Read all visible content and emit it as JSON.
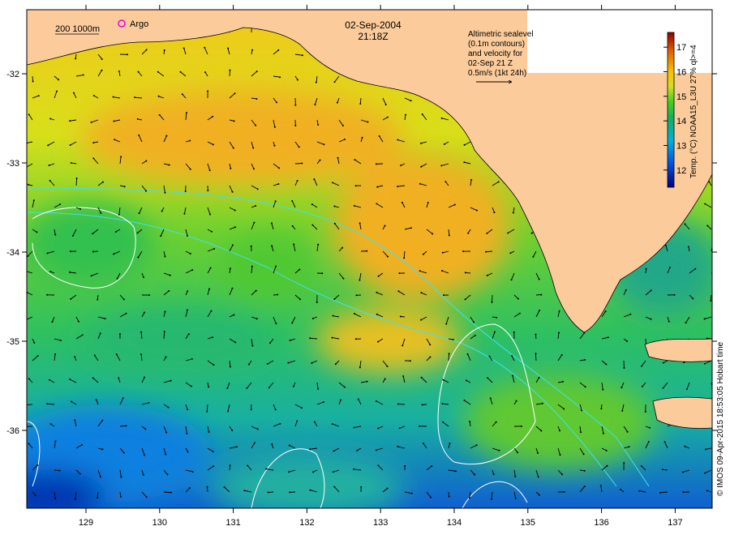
{
  "title": {
    "date": "02-Sep-2004",
    "time": "21:18Z"
  },
  "legend": {
    "isobaths": "200  1000m",
    "argo": "Argo"
  },
  "annotation": {
    "lines": [
      "Altimetric sealevel",
      "(0.1m contours)",
      "and velocity for",
      "02-Sep 21 Z",
      "0.5m/s (1kt 24h)"
    ]
  },
  "colorbar": {
    "label": "Temp. (°C) NOAA15_L3U 27% ql>=4",
    "ticks": [
      "12",
      "13",
      "14",
      "15",
      "16",
      "17"
    ],
    "range": [
      11.3,
      17.6
    ]
  },
  "credit": "© IMOS 09-Apr-2015 18:53:05 Hobart time",
  "axes": {
    "lon_ticks": [
      "129",
      "130",
      "131",
      "132",
      "133",
      "134",
      "135",
      "136",
      "137"
    ],
    "lat_ticks": [
      "-32",
      "-33",
      "-34",
      "-35",
      "-36"
    ]
  },
  "colors": {
    "land": "#FCCB9B",
    "argo": "#E000E0",
    "contour": "#FFFFFF",
    "isobath": "#40E0F0"
  }
}
